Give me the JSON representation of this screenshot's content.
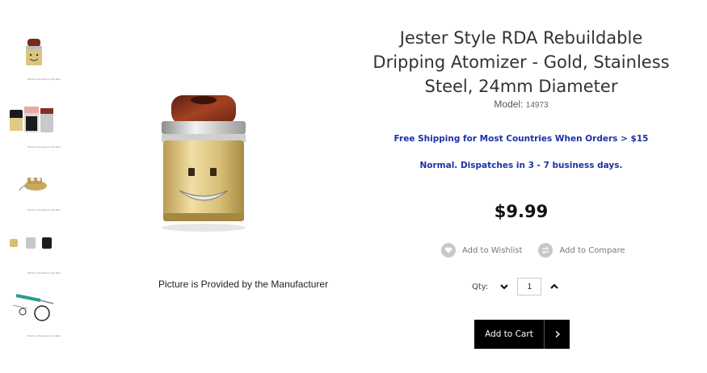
{
  "product": {
    "title_lines": [
      "Jester Style RDA Rebuildable",
      "Dripping Atomizer - Gold, Stainless",
      "Steel, 24mm Diameter"
    ],
    "model_label": "Model:",
    "model_number": "14973",
    "shipping_notice": "Free Shipping for Most Countries When Orders > $15",
    "dispatch_notice": "Normal. Dispatches in 3 - 7 business days.",
    "price": "$9.99"
  },
  "gallery": {
    "main_caption": "Picture is Provided by the Manufacturer",
    "thumb_caption": "Picture is Provided by the Man"
  },
  "actions": {
    "wishlist_label": "Add to Wishlist",
    "compare_label": "Add to Compare",
    "wishlist_icon": "heart-icon",
    "compare_icon": "compare-icon"
  },
  "quantity": {
    "label": "Qty:",
    "value": "1"
  },
  "cart": {
    "button_label": "Add to Cart"
  },
  "colors": {
    "notice_blue": "#1d32a8",
    "cart_black": "#000000",
    "gold": "#d9bf74"
  }
}
